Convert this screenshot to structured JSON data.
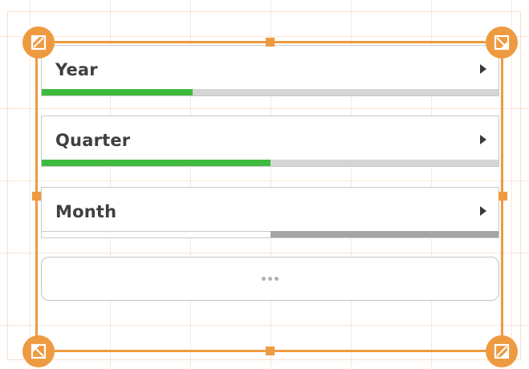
{
  "filters": [
    {
      "label": "Year",
      "selected_fraction": 0.33,
      "excluded_fraction": 0
    },
    {
      "label": "Quarter",
      "selected_fraction": 0.5,
      "excluded_fraction": 0
    },
    {
      "label": "Month",
      "selected_fraction": 0,
      "excluded_fraction": 0.5
    }
  ],
  "colors": {
    "selection_frame": "#ee9a40",
    "selected": "#3fba3f",
    "possible": "#d5d5d5",
    "excluded": "#a5a5a5"
  },
  "icons": {
    "expand": "caret-right-icon",
    "more": "ellipsis-icon",
    "resize": "resize-diagonal-icon"
  }
}
